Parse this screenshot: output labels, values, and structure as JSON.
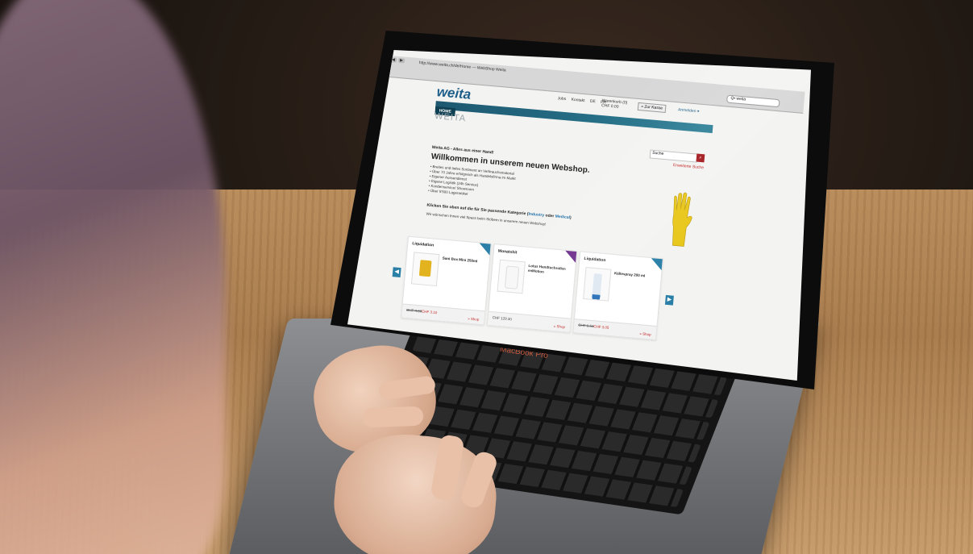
{
  "browser": {
    "url": "http://www.weita.ch/de/Home — WebShop Weita",
    "search_value": "Q• weita"
  },
  "header": {
    "logo": "weita",
    "links": [
      "Jobs",
      "Kontakt",
      "DE",
      "FR"
    ],
    "cart_label": "Warenkorb (0)",
    "cart_total": "CHF 0.00",
    "checkout_label": "» Zur Kasse",
    "login_label": "Anmelden ▾"
  },
  "nav": {
    "home": "HOME"
  },
  "page_title": "WEITA",
  "search": {
    "placeholder": "Suche",
    "advanced": "Erweiterte Suche"
  },
  "intro": {
    "tagline": "Weita AG - Alles aus einer Hand!",
    "heading": "Willkommen in unserem neuen Webshop.",
    "bullets": [
      "• Breites und tiefes Sortiment an Verbrauchsmaterial",
      "• Über 70 Jahre erfolgreich als Handelsfirma im Markt",
      "• Eigener Aussendienst",
      "• Eigene Logistik (24h Service)",
      "• Kundenservice/ Showroom",
      "• Über 5'500 Lagerartikel"
    ],
    "cta_prefix": "Klicken Sie oben auf die für Sie passende Kategorie (",
    "cta_industry": "Industry",
    "cta_oder": " oder ",
    "cta_medical": "Medical",
    "cta_suffix": ")",
    "wish": "Wir wünschen Ihnen viel Spass beim Stöbern in unserem neuen Webshop!"
  },
  "carousel": {
    "prev": "◀",
    "next": "▶",
    "cards": [
      {
        "category": "Liquidation",
        "name": "Sani Box Mini 250ml",
        "old_price": "CHF 4.60",
        "new_price": "CHF 3.10",
        "shop": "» Shop"
      },
      {
        "category": "Monatshit",
        "name": "Lotus Handtuchrollen enMotion",
        "price": "CHF 129.30",
        "shop": "» Shop"
      },
      {
        "category": "Liquidation",
        "name": "Kältespray 200 ml",
        "old_price": "CHF 6.50",
        "new_price": "CHF 3.05",
        "shop": "» Shop"
      }
    ]
  },
  "laptop": {
    "brand": "MacBook Pro"
  },
  "colors": {
    "brand_blue": "#1e5f8a",
    "nav_teal": "#2c7f96",
    "accent_red": "#a3171c",
    "glove_yellow": "#e8c619"
  }
}
